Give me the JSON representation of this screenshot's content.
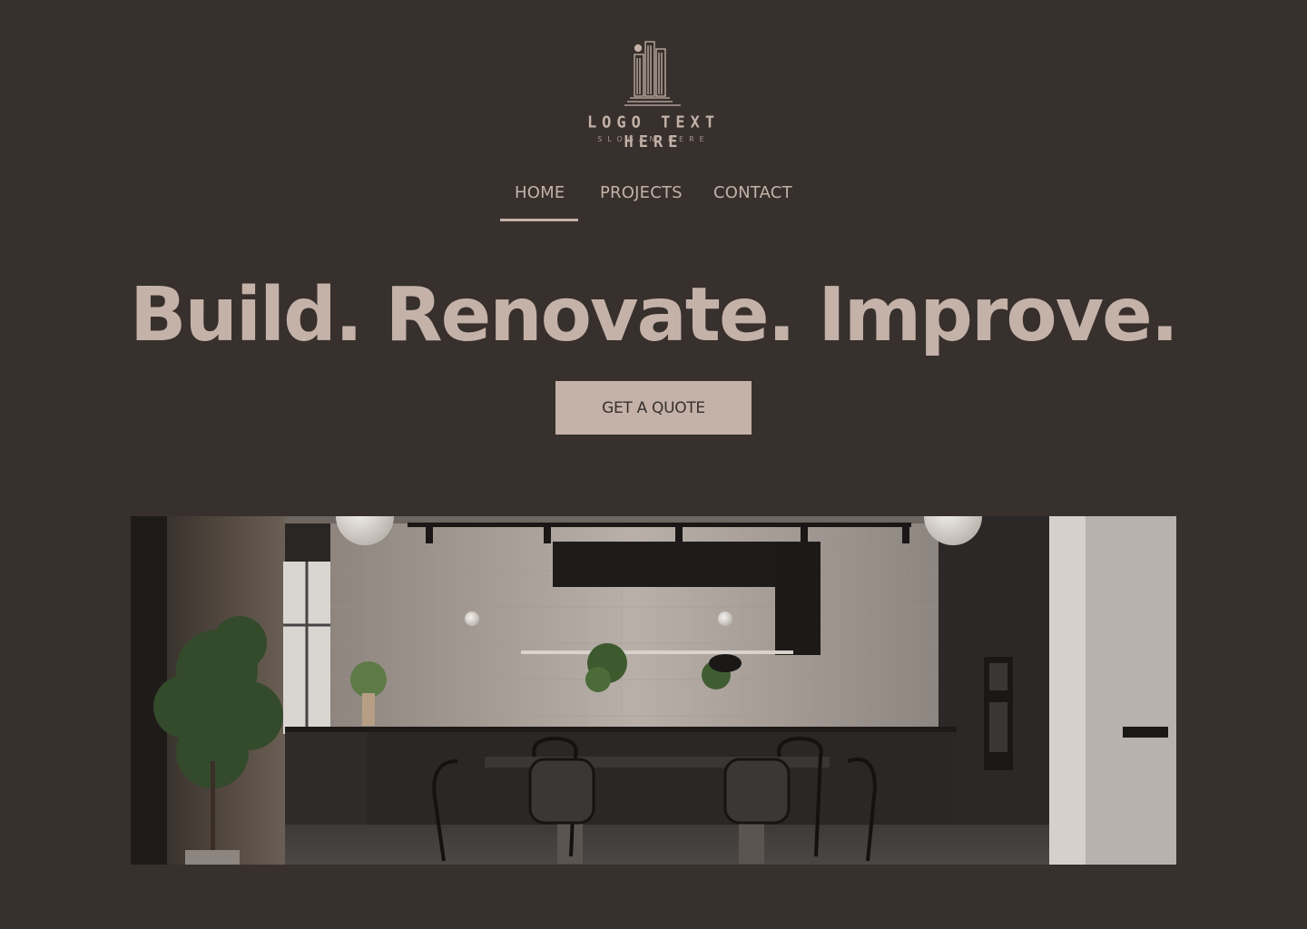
{
  "brand": {
    "logo_text": "LOGO TEXT HERE",
    "slogan": "SLOGAN HERE",
    "logo_icon": "building-icon"
  },
  "nav": {
    "items": [
      {
        "label": "HOME",
        "active": true
      },
      {
        "label": "PROJECTS",
        "active": false
      },
      {
        "label": "CONTACT",
        "active": false
      }
    ]
  },
  "hero": {
    "headline": "Build. Renovate. Improve.",
    "cta_label": "GET A QUOTE",
    "image": "kitchen-dining-interior-photo"
  },
  "colors": {
    "background": "#37302d",
    "accent": "#c4b2a8",
    "cta_text": "#37302d"
  }
}
